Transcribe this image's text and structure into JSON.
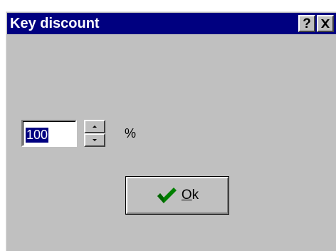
{
  "window": {
    "title": "Key discount",
    "help_label": "?",
    "close_icon": "close-icon"
  },
  "discount": {
    "value": "100",
    "unit": "%"
  },
  "ok_button": {
    "mnemonic": "O",
    "rest": "k",
    "icon": "checkmark-icon",
    "icon_color": "#008000"
  },
  "colors": {
    "titlebar": "#000080",
    "face": "#c0c0c0",
    "selection": "#000080"
  }
}
